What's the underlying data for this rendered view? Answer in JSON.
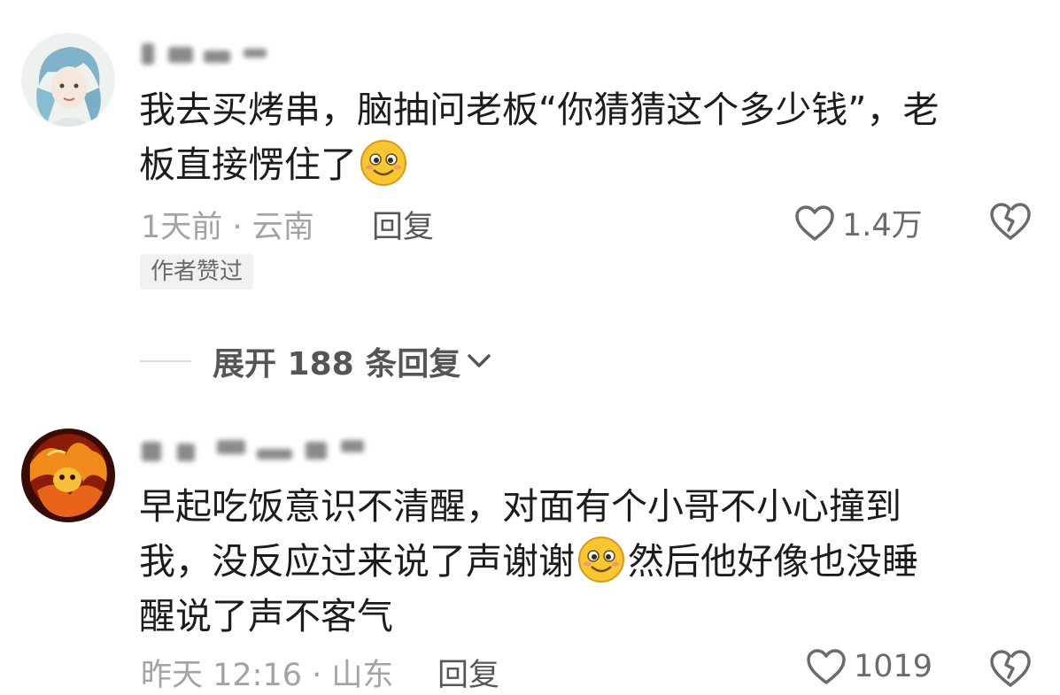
{
  "comments": [
    {
      "text_lines": [
        "我去买烤串，脑抽问老板“你猜猜这个多少钱”，老",
        "板直接愣住了"
      ],
      "meta": "1天前 · 云南",
      "reply_label": "回复",
      "like_count": "1.4万",
      "author_badge": "作者赞过",
      "expand_label": "展开 188 条回复"
    },
    {
      "text_lines": [
        "早起吃饭意识不清醒，对面有个小哥不小心撞到",
        "我，没反应过来说了声谢谢",
        "然后他好像也没睡",
        "醒说了声不客气"
      ],
      "meta": "昨天 12:16 · 山东",
      "reply_label": "回复",
      "like_count": "1019"
    }
  ],
  "icons": {
    "like": "heart-outline-icon",
    "dislike": "broken-heart-icon",
    "expand": "chevron-down-icon",
    "emoji": "smiling-face-emoji"
  },
  "colors": {
    "text": "#1c1c1c",
    "meta": "#a3a3a3",
    "badge_bg": "#f1f1f1",
    "emoji_yellow": "#f7c631"
  }
}
